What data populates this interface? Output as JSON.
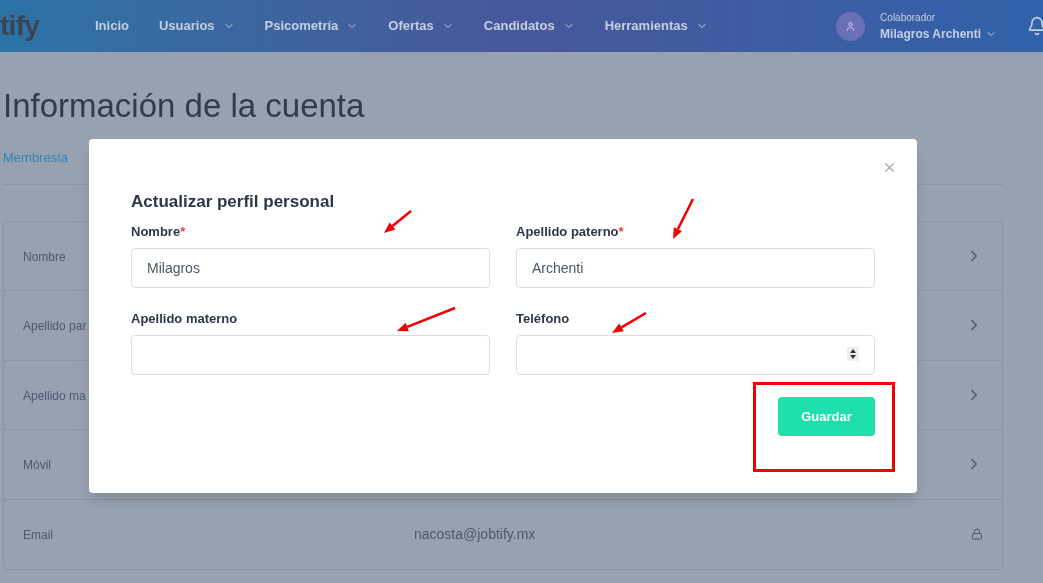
{
  "nav": {
    "brand": "tify",
    "items": [
      {
        "label": "Inicio",
        "dropdown": false
      },
      {
        "label": "Usuarios",
        "dropdown": true
      },
      {
        "label": "Psicometría",
        "dropdown": true
      },
      {
        "label": "Ofertas",
        "dropdown": true
      },
      {
        "label": "Candidatos",
        "dropdown": true
      },
      {
        "label": "Herramientas",
        "dropdown": true
      }
    ],
    "user": {
      "role": "Colaborador",
      "name": "Milagros Archenti"
    }
  },
  "page_title": "Información de la cuenta",
  "tabs": [
    {
      "label": "Membresía",
      "selected": true
    }
  ],
  "account_rows": [
    {
      "label": "Nombre",
      "kind": "editable"
    },
    {
      "label": "Apellido par",
      "kind": "editable"
    },
    {
      "label": "Apellido ma",
      "kind": "editable"
    },
    {
      "label": "Móvil",
      "kind": "editable"
    },
    {
      "label": "Email",
      "value": "nacosta@jobtify.mx",
      "kind": "locked"
    }
  ],
  "modal": {
    "title": "Actualizar perfil personal",
    "fields": [
      {
        "label": "Nombre",
        "required": true,
        "value": "Milagros",
        "kind": "text"
      },
      {
        "label": "Apellido paterno",
        "required": true,
        "value": "Archenti",
        "kind": "text"
      },
      {
        "label": "Apellido materno",
        "required": false,
        "kind": "text"
      },
      {
        "label": "Teléfono",
        "required": false,
        "kind": "number"
      }
    ],
    "required_mark": "*",
    "save_button": "Guardar"
  }
}
